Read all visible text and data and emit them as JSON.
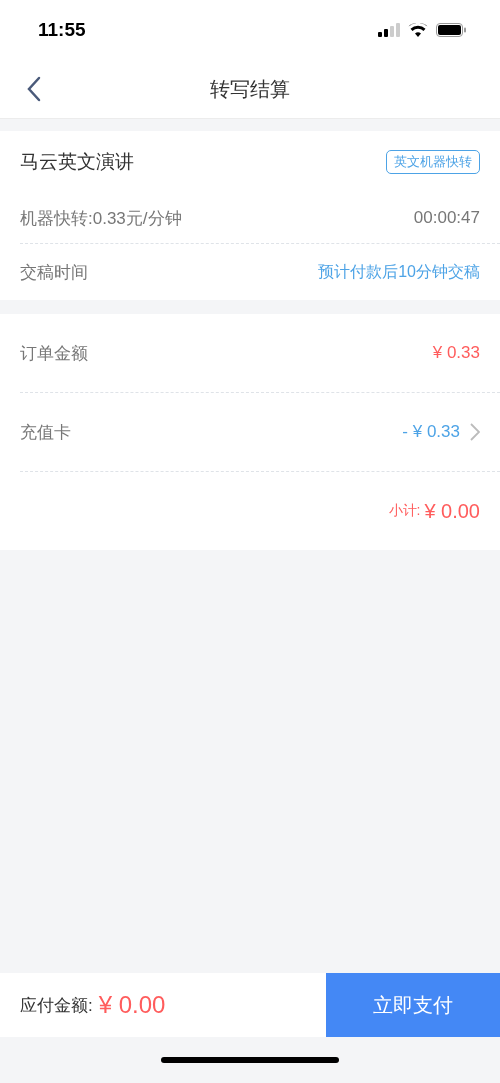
{
  "status_bar": {
    "time": "11:55"
  },
  "nav": {
    "title": "转写结算"
  },
  "order": {
    "title": "马云英文演讲",
    "tag": "英文机器快转",
    "rate": "机器快转:0.33元/分钟",
    "duration": "00:00:47",
    "delivery_label": "交稿时间",
    "delivery_value": "预计付款后10分钟交稿"
  },
  "charges": [
    {
      "kind": "amount",
      "label": "订单金额",
      "value": "¥ 0.33"
    },
    {
      "kind": "discount",
      "label": "充值卡",
      "value": "- ¥ 0.33"
    },
    {
      "kind": "subtotal",
      "label": "小计:",
      "value": "¥ 0.00"
    }
  ],
  "footer": {
    "label": "应付金额:",
    "amount": "¥ 0.00",
    "button": "立即支付"
  }
}
